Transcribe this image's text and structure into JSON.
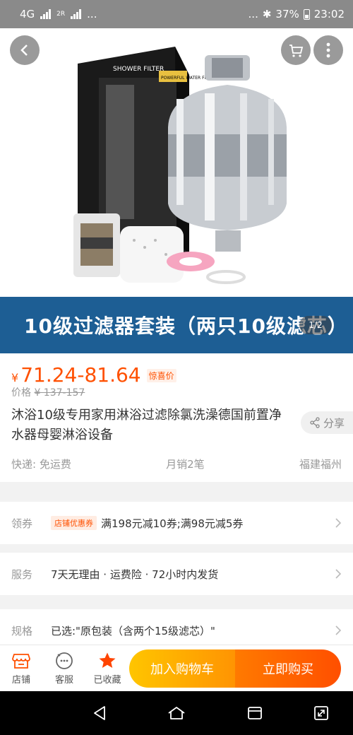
{
  "status_bar": {
    "network": "4G",
    "sim1": "1",
    "sim2": "2R",
    "dots_left": "...",
    "dots_right": "...",
    "battery": "37%",
    "time": "23:02"
  },
  "hero": {
    "box_label": "SHOWER FILTER",
    "box_sublabel": "POWERFUL WATER FILTRATION",
    "page_indicator": "1/2"
  },
  "banner": {
    "text": "10级过滤器套装（两只10级滤芯）"
  },
  "product": {
    "currency": "¥",
    "price_range": "71.24-81.64",
    "price_tag": "惊喜价",
    "orig_label": "价格",
    "orig_price": "¥ 137-157",
    "title": "沐浴10级专用家用淋浴过滤除氯洗澡德国前置净水器母婴淋浴设备",
    "share": "分享",
    "shipping": "快递: 免运费",
    "monthly_sales": "月销2笔",
    "location": "福建福州"
  },
  "coupon_row": {
    "label": "领券",
    "tag": "店铺优惠券",
    "text": "满198元减10券;满98元减5券"
  },
  "service_row": {
    "label": "服务",
    "text": "7天无理由 · 运费险 · 72小时内发货"
  },
  "spec_row": {
    "label": "规格",
    "text": "已选:\"原包装（含两个15级滤芯）\""
  },
  "bottom_bar": {
    "shop": "店铺",
    "service": "客服",
    "favorited": "已收藏",
    "add_to_cart": "加入购物车",
    "buy_now": "立即购买"
  },
  "colors": {
    "accent": "#ff5000",
    "cart_gradient_start": "#ffc500",
    "banner_bg": "#1d5e94",
    "star": "#ff4400"
  }
}
